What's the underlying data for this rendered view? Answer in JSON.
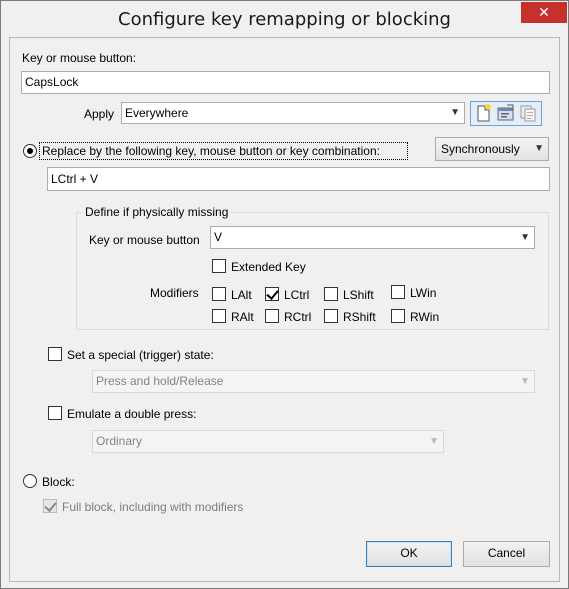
{
  "window": {
    "title": "Configure key remapping or blocking",
    "close_glyph": "✕"
  },
  "source": {
    "label": "Key or mouse button:",
    "value": "CapsLock"
  },
  "apply": {
    "label": "Apply",
    "value": "Everywhere",
    "icons": [
      "new-document-icon",
      "properties-icon",
      "copy-icon"
    ]
  },
  "replace": {
    "label": "Replace by the following key, mouse button or key combination:",
    "selected": true,
    "mode": "Synchronously",
    "value": "LCtrl + V"
  },
  "missing": {
    "title": "Define if physically missing",
    "key_label": "Key or mouse button",
    "key_value": "V",
    "extended_key": {
      "label": "Extended Key",
      "checked": false
    },
    "modifiers_label": "Modifiers",
    "modifiers": [
      {
        "label": "LAlt",
        "checked": false
      },
      {
        "label": "LCtrl",
        "checked": true
      },
      {
        "label": "LShift",
        "checked": false
      },
      {
        "label": "LWin",
        "checked": false
      },
      {
        "label": "RAlt",
        "checked": false
      },
      {
        "label": "RCtrl",
        "checked": false
      },
      {
        "label": "RShift",
        "checked": false
      },
      {
        "label": "RWin",
        "checked": false
      }
    ]
  },
  "trigger": {
    "label": "Set a special (trigger) state:",
    "checked": false,
    "value": "Press and hold/Release"
  },
  "double": {
    "label": "Emulate a double press:",
    "checked": false,
    "value": "Ordinary"
  },
  "block": {
    "label": "Block:",
    "selected": false,
    "full": {
      "label": "Full block, including with modifiers",
      "checked": true,
      "enabled": false
    }
  },
  "buttons": {
    "ok": "OK",
    "cancel": "Cancel"
  },
  "glyphs": {
    "dropdown": "▼"
  }
}
